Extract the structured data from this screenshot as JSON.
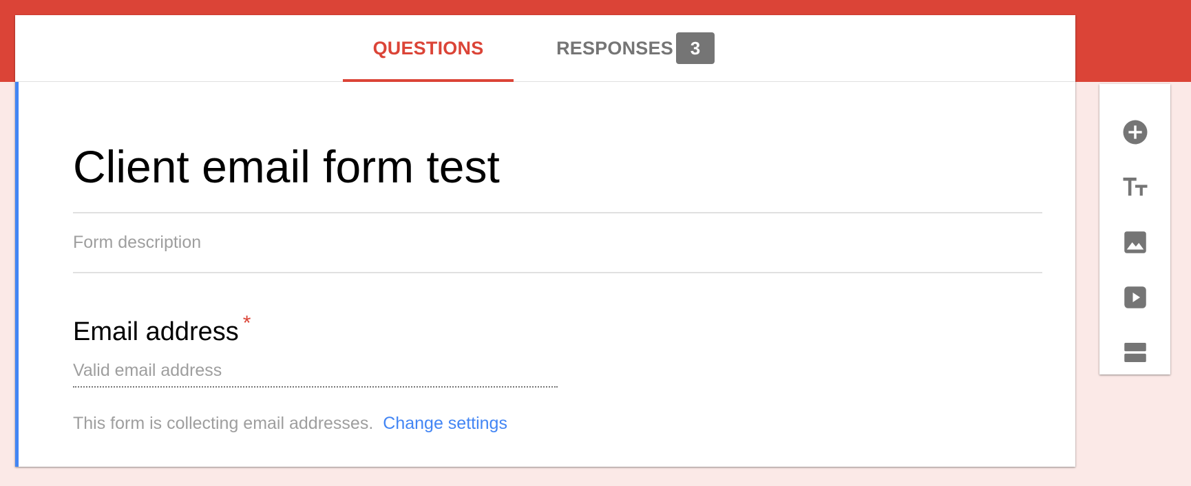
{
  "tabs": {
    "questions_label": "QUESTIONS",
    "responses_label": "RESPONSES",
    "responses_count": "3"
  },
  "form": {
    "title": "Client email form test",
    "description_placeholder": "Form description",
    "question": {
      "title": "Email address",
      "required_marker": "*",
      "answer_placeholder": "Valid email address"
    },
    "collect_note": "This form is collecting email addresses.",
    "change_settings_label": "Change settings"
  },
  "toolbar": {
    "tools": [
      {
        "icon": "add-circle-icon"
      },
      {
        "icon": "title-text-icon"
      },
      {
        "icon": "image-icon"
      },
      {
        "icon": "video-icon"
      },
      {
        "icon": "section-icon"
      }
    ]
  },
  "colors": {
    "brand_red": "#db4437",
    "accent_blue": "#4285f4",
    "icon_gray": "#757575",
    "page_background": "#fbe9e7"
  }
}
